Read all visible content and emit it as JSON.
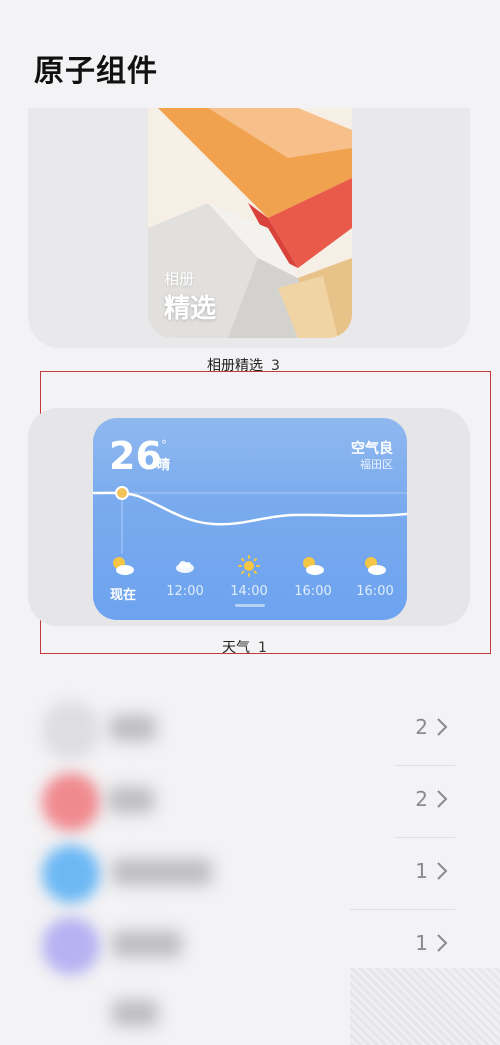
{
  "header": {
    "title": "原子组件"
  },
  "photo_widget": {
    "small_label": "相册",
    "big_label": "精选",
    "caption": "相册精选",
    "count": "3"
  },
  "weather_widget": {
    "temperature": "26",
    "degree_mark": "°",
    "condition": "晴",
    "air_quality": "空气良",
    "district": "福田区",
    "forecast": [
      {
        "time": "现在",
        "icon": "partly-cloudy-icon"
      },
      {
        "time": "12:00",
        "icon": "cloud-icon"
      },
      {
        "time": "14:00",
        "icon": "sun-icon"
      },
      {
        "time": "16:00",
        "icon": "partly-cloudy-icon"
      },
      {
        "time": "16:00",
        "icon": "partly-cloudy-icon"
      }
    ],
    "caption": "天气",
    "count": "1"
  },
  "list": {
    "items": [
      {
        "count": "2",
        "avatar_color": "#d8d7db"
      },
      {
        "count": "2",
        "avatar_color": "#f08a8f"
      },
      {
        "count": "1",
        "avatar_color": "#6cb8f5"
      },
      {
        "count": "1",
        "avatar_color": "#b7b2f2"
      },
      {
        "count": "",
        "avatar_color": "#d8d7db"
      }
    ]
  },
  "colors": {
    "background": "#f3f2f4",
    "selection_frame": "#c23a3a",
    "weather_blue": "#79aaee"
  }
}
